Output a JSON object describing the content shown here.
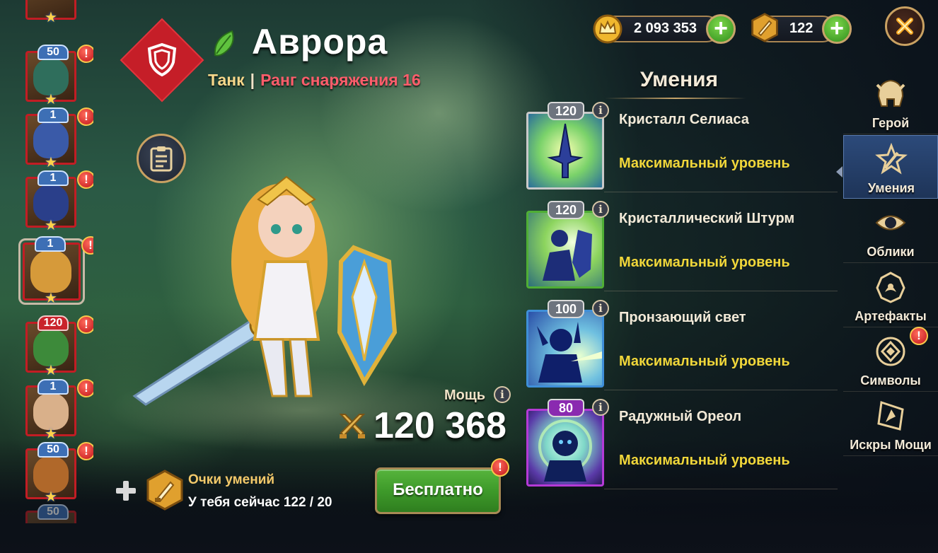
{
  "hero": {
    "name": "Аврора",
    "role": "Танк",
    "separator": "|",
    "rank": "Ранг снаряжения 16",
    "role_icon": "shield-icon",
    "element_icon": "leaf-icon"
  },
  "currency": {
    "gold": "2 093 353",
    "gold_icon": "crown-coin-icon",
    "skill_points": "122",
    "skill_points_icon": "sword-hex-icon"
  },
  "power": {
    "label": "Мощь",
    "value": "120 368",
    "info": "i"
  },
  "skill_points_panel": {
    "title": "Очки умений",
    "text": "У тебя сейчас 122 / 20"
  },
  "free_button": {
    "label": "Бесплатно",
    "alert": "!"
  },
  "skills": {
    "header": "Умения",
    "items": [
      {
        "level": "120",
        "name": "Кристалл Селиаса",
        "status": "Максимальный уровень",
        "info": "i",
        "frame": "#c9c9c9"
      },
      {
        "level": "120",
        "name": "Кристаллический Штурм",
        "status": "Максимальный уровень",
        "info": "i",
        "frame": "#4fae35"
      },
      {
        "level": "100",
        "name": "Пронзающий свет",
        "status": "Максимальный уровень",
        "info": "i",
        "frame": "#3f8fd8"
      },
      {
        "level": "80",
        "name": "Радужный Ореол",
        "status": "Максимальный уровень",
        "info": "i",
        "frame": "#b43ad6"
      }
    ]
  },
  "nav": {
    "items": [
      {
        "label": "Герой",
        "icon": "helmet-icon"
      },
      {
        "label": "Умения",
        "icon": "skill-star-icon"
      },
      {
        "label": "Облики",
        "icon": "eye-icon"
      },
      {
        "label": "Артефакты",
        "icon": "artifact-icon"
      },
      {
        "label": "Символы",
        "icon": "glyph-icon"
      },
      {
        "label": "Искры Мощи",
        "icon": "spark-icon"
      }
    ],
    "active": "Умения",
    "alert": "!"
  },
  "hero_list": {
    "items": [
      {
        "level": "50",
        "alert": "!",
        "tone": "#2f6e5c"
      },
      {
        "level": "1",
        "alert": "!",
        "tone": "#3a5aa8"
      },
      {
        "level": "1",
        "alert": "!",
        "tone": "#2a3f8a"
      },
      {
        "level": "1",
        "alert": "!",
        "tone": "#d69a3a"
      },
      {
        "level": "120",
        "alert": "!",
        "tone": "#3d8a3a"
      },
      {
        "level": "1",
        "alert": "!",
        "tone": "#d9b08a"
      },
      {
        "level": "50",
        "alert": "!",
        "tone": "#b0682a"
      }
    ],
    "partial_bottom_level": "50",
    "star": "★"
  },
  "close_icon": "close-icon",
  "colors": {
    "accent_gold": "#c9a162",
    "rank_red": "#ff5d6b",
    "status_yellow": "#f1d73a",
    "button_green": "#3e9a2a"
  }
}
